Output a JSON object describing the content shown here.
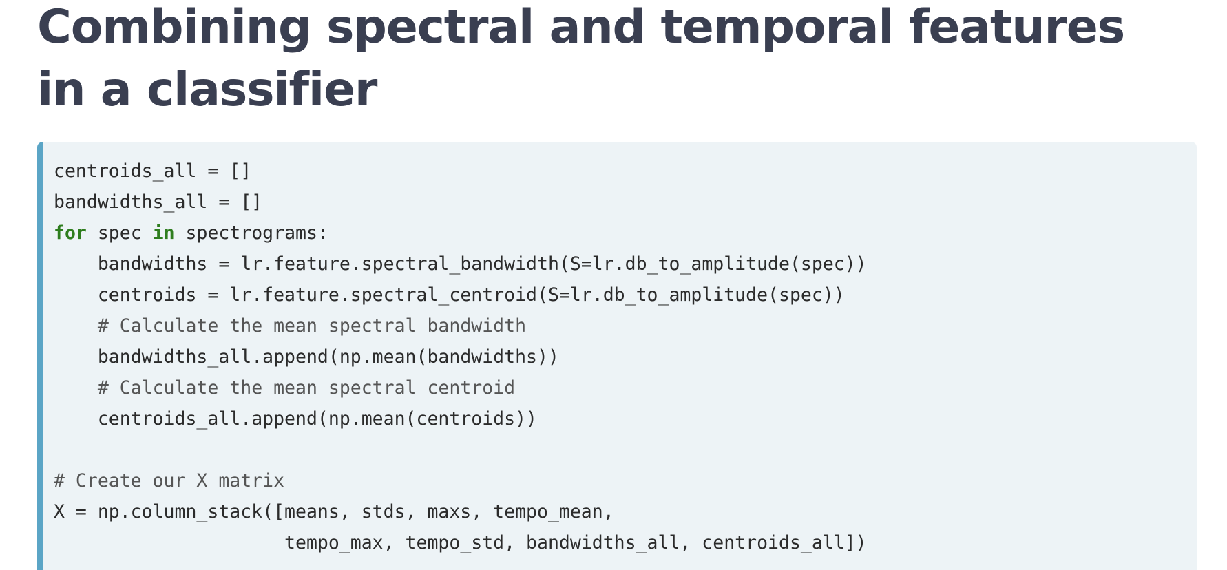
{
  "page": {
    "title": "Combining spectral and temporal features in a classifier"
  },
  "code": {
    "lines": [
      {
        "indent": "",
        "parts": [
          {
            "t": "centroids_all = []",
            "k": "plain"
          }
        ]
      },
      {
        "indent": "",
        "parts": [
          {
            "t": "bandwidths_all = []",
            "k": "plain"
          }
        ]
      },
      {
        "indent": "",
        "parts": [
          {
            "t": "for",
            "k": "keyword"
          },
          {
            "t": " spec ",
            "k": "plain"
          },
          {
            "t": "in",
            "k": "keyword"
          },
          {
            "t": " spectrograms:",
            "k": "plain"
          }
        ]
      },
      {
        "indent": "    ",
        "parts": [
          {
            "t": "bandwidths = lr.feature.spectral_bandwidth(S=lr.db_to_amplitude(spec))",
            "k": "plain"
          }
        ]
      },
      {
        "indent": "    ",
        "parts": [
          {
            "t": "centroids = lr.feature.spectral_centroid(S=lr.db_to_amplitude(spec))",
            "k": "plain"
          }
        ]
      },
      {
        "indent": "    ",
        "parts": [
          {
            "t": "# Calculate the mean spectral bandwidth",
            "k": "comment"
          }
        ]
      },
      {
        "indent": "    ",
        "parts": [
          {
            "t": "bandwidths_all.append(np.mean(bandwidths))",
            "k": "plain"
          }
        ]
      },
      {
        "indent": "    ",
        "parts": [
          {
            "t": "# Calculate the mean spectral centroid",
            "k": "comment"
          }
        ]
      },
      {
        "indent": "    ",
        "parts": [
          {
            "t": "centroids_all.append(np.mean(centroids))",
            "k": "plain"
          }
        ]
      },
      {
        "indent": "",
        "parts": []
      },
      {
        "indent": "",
        "parts": [
          {
            "t": "# Create our X matrix",
            "k": "comment"
          }
        ]
      },
      {
        "indent": "",
        "parts": [
          {
            "t": "X = np.column_stack([means, stds, maxs, tempo_mean,",
            "k": "plain"
          }
        ]
      },
      {
        "indent": "                     ",
        "parts": [
          {
            "t": "tempo_max, tempo_std, bandwidths_all, centroids_all])",
            "k": "plain"
          }
        ]
      }
    ]
  }
}
